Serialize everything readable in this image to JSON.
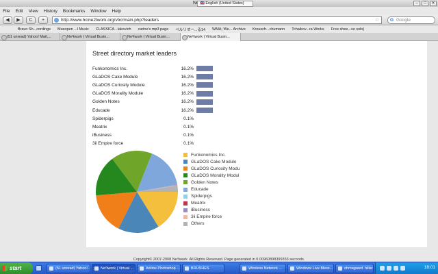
{
  "window": {
    "title_prefix": "Ne²two",
    "lang_selector": "🇬🇧 English (United States)",
    "controls": [
      "–",
      "□",
      "✕"
    ]
  },
  "menu": [
    "File",
    "Edit",
    "View",
    "History",
    "Bookmarks",
    "Window",
    "Help"
  ],
  "nav": {
    "back": "◀",
    "forward": "▶",
    "reload": "C",
    "new": "+",
    "url": "http://www.hcine2twork.org/vbc/main.php?leaders",
    "search_placeholder": "Google"
  },
  "bookmarks": [
    "Bravo Sh...cordings",
    "Musopen ...l Music",
    "CLASSICA...lakovich",
    "carine's mp3 page",
    "ベルリオー...る14",
    "WMA; We... Archive",
    "Kreusch...chumann",
    "Tchaikov...ra Works",
    "Free shee...so solo)"
  ],
  "tabs": [
    "(51 unread) Yahoo! Mail,...",
    "Ne²twork | Virtual Busin...",
    "Ne²twork | Virtual Busin...",
    "Ne²twork | Virtual Busin..."
  ],
  "page": {
    "title": "Street directory market leaders",
    "leaders": [
      {
        "name": "Funkonomics Inc.",
        "pct": "16.2%",
        "value": 16.2
      },
      {
        "name": "GLaDOS Cake Module",
        "pct": "16.2%",
        "value": 16.2
      },
      {
        "name": "GLaDOS Curiosity Module",
        "pct": "16.2%",
        "value": 16.2
      },
      {
        "name": "GLaDOS Morality Module",
        "pct": "16.2%",
        "value": 16.2
      },
      {
        "name": "Golden Notes",
        "pct": "16.2%",
        "value": 16.2
      },
      {
        "name": "Educade",
        "pct": "16.2%",
        "value": 16.2
      },
      {
        "name": "Spiderpigs",
        "pct": "0.1%",
        "value": 0.1
      },
      {
        "name": "Meatrix",
        "pct": "0.1%",
        "value": 0.1
      },
      {
        "name": "iBusiness",
        "pct": "0.1%",
        "value": 0.1
      },
      {
        "name": "3ii Empire force",
        "pct": "0.1%",
        "value": 0.1
      }
    ],
    "footer": "Copyright© 2007-2008 Ne²twork. All Rights Reserved. Page generated in 0.00960898399353 seconds."
  },
  "chart_data": {
    "type": "pie",
    "categories": [
      "Funkonomics Inc.",
      "GLaDOS Cake Module",
      "GLaDOS Curiosity Modu",
      "GLaDOS Morality Modul",
      "Golden Notes",
      "Educade",
      "Spiderpigs",
      "Meatrix",
      "iBusiness",
      "3ii Empire force",
      "Others"
    ],
    "values": [
      16.2,
      16.2,
      16.2,
      16.2,
      16.2,
      16.2,
      0.1,
      0.1,
      0.1,
      0.1,
      2.4
    ],
    "colors": [
      "#f4bf3c",
      "#4a86b8",
      "#f07f19",
      "#24881f",
      "#6fa62a",
      "#7fa7dc",
      "#8fd0ec",
      "#c2324a",
      "#9b8bc2",
      "#f1b8a8",
      "#b3b3b3"
    ],
    "legend_position": "right"
  },
  "taskbar": {
    "start": "start",
    "items": [
      "(51 unread) Yahoo!...",
      "Ne²twork | Virtual ...",
      "Adobe Photoshop ...",
      "BRUSHES",
      "Wireless Network ...",
      "Windows Live Mess...",
      "ohmagawd. hillario..."
    ],
    "clock": "18:01"
  }
}
